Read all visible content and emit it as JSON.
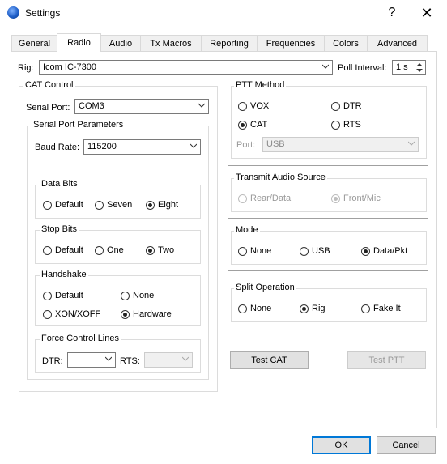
{
  "window": {
    "title": "Settings",
    "help_glyph": "?",
    "close_glyph": "✕"
  },
  "tabs": [
    "General",
    "Radio",
    "Audio",
    "Tx Macros",
    "Reporting",
    "Frequencies",
    "Colors",
    "Advanced"
  ],
  "active_tab": "Radio",
  "rig": {
    "label": "Rig:",
    "value": "Icom IC-7300"
  },
  "poll": {
    "label": "Poll Interval:",
    "value": "1 s"
  },
  "cat_control": {
    "title": "CAT Control",
    "serial_port_label": "Serial Port:",
    "serial_port_value": "COM3",
    "params_title": "Serial Port Parameters",
    "baud_label": "Baud Rate:",
    "baud_value": "115200",
    "data_bits": {
      "title": "Data Bits",
      "options": [
        "Default",
        "Seven",
        "Eight"
      ],
      "selected": "Eight"
    },
    "stop_bits": {
      "title": "Stop Bits",
      "options": [
        "Default",
        "One",
        "Two"
      ],
      "selected": "Two"
    },
    "handshake": {
      "title": "Handshake",
      "options": [
        "Default",
        "None",
        "XON/XOFF",
        "Hardware"
      ],
      "selected": "Hardware"
    },
    "force_lines": {
      "title": "Force Control Lines",
      "dtr_label": "DTR:",
      "rts_label": "RTS:"
    }
  },
  "ptt_method": {
    "title": "PTT Method",
    "options": [
      "VOX",
      "DTR",
      "CAT",
      "RTS"
    ],
    "selected": "CAT",
    "port_label": "Port:",
    "port_value": "USB"
  },
  "transmit_audio": {
    "title": "Transmit Audio Source",
    "options": [
      "Rear/Data",
      "Front/Mic"
    ],
    "selected": "Front/Mic"
  },
  "mode": {
    "title": "Mode",
    "options": [
      "None",
      "USB",
      "Data/Pkt"
    ],
    "selected": "Data/Pkt"
  },
  "split": {
    "title": "Split Operation",
    "options": [
      "None",
      "Rig",
      "Fake It"
    ],
    "selected": "Rig"
  },
  "buttons": {
    "test_cat": "Test CAT",
    "test_ptt": "Test PTT",
    "ok": "OK",
    "cancel": "Cancel"
  }
}
